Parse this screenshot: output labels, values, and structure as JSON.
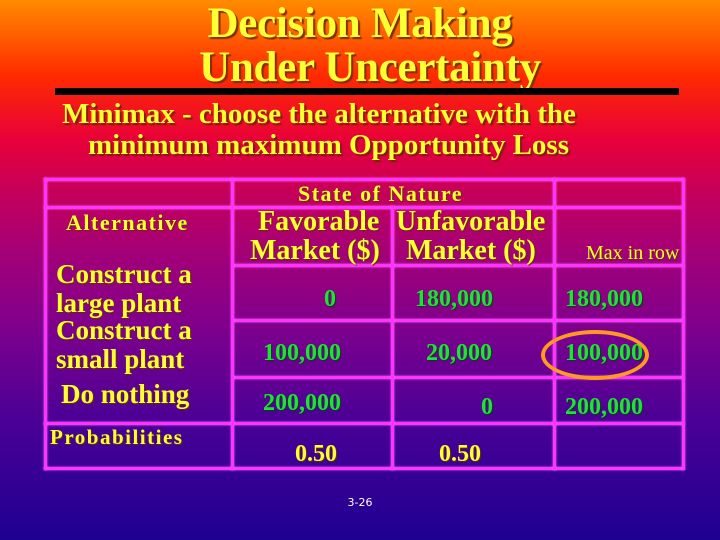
{
  "slide": {
    "title_line1": "Decision Making",
    "title_line2": "Under Uncertainty",
    "subtitle_line1": "Minimax - choose the alternative with the",
    "subtitle_line2": "minimum maximum Opportunity Loss",
    "page_number": "3-26"
  },
  "table": {
    "state_header": "State of Nature",
    "alternative_header": "Alternative",
    "col_favorable_line1": "Favorable",
    "col_favorable_line2": "Market ($)",
    "col_unfavorable_line1": "Unfavorable",
    "col_unfavorable_line2": "Market ($)",
    "col_max": "Max in row",
    "rows": [
      {
        "alt_line1": "Construct a",
        "alt_line2": "large plant",
        "favorable": "0",
        "unfavorable": "180,000",
        "max": "180,000"
      },
      {
        "alt_line1": "Construct a",
        "alt_line2": "small plant",
        "favorable": "100,000",
        "unfavorable": "20,000",
        "max": "100,000"
      },
      {
        "alt_line1": "Do nothing",
        "alt_line2": "",
        "favorable": "200,000",
        "unfavorable": "0",
        "max": "200,000"
      }
    ],
    "probabilities_label": "Probabilities",
    "prob_favorable": "0.50",
    "prob_unfavorable": "0.50",
    "highlighted_row": 1
  },
  "colors": {
    "title": "#ffff33",
    "values": "#22e03a",
    "grid": "#ff33ff",
    "highlight": "#ff9a20"
  }
}
